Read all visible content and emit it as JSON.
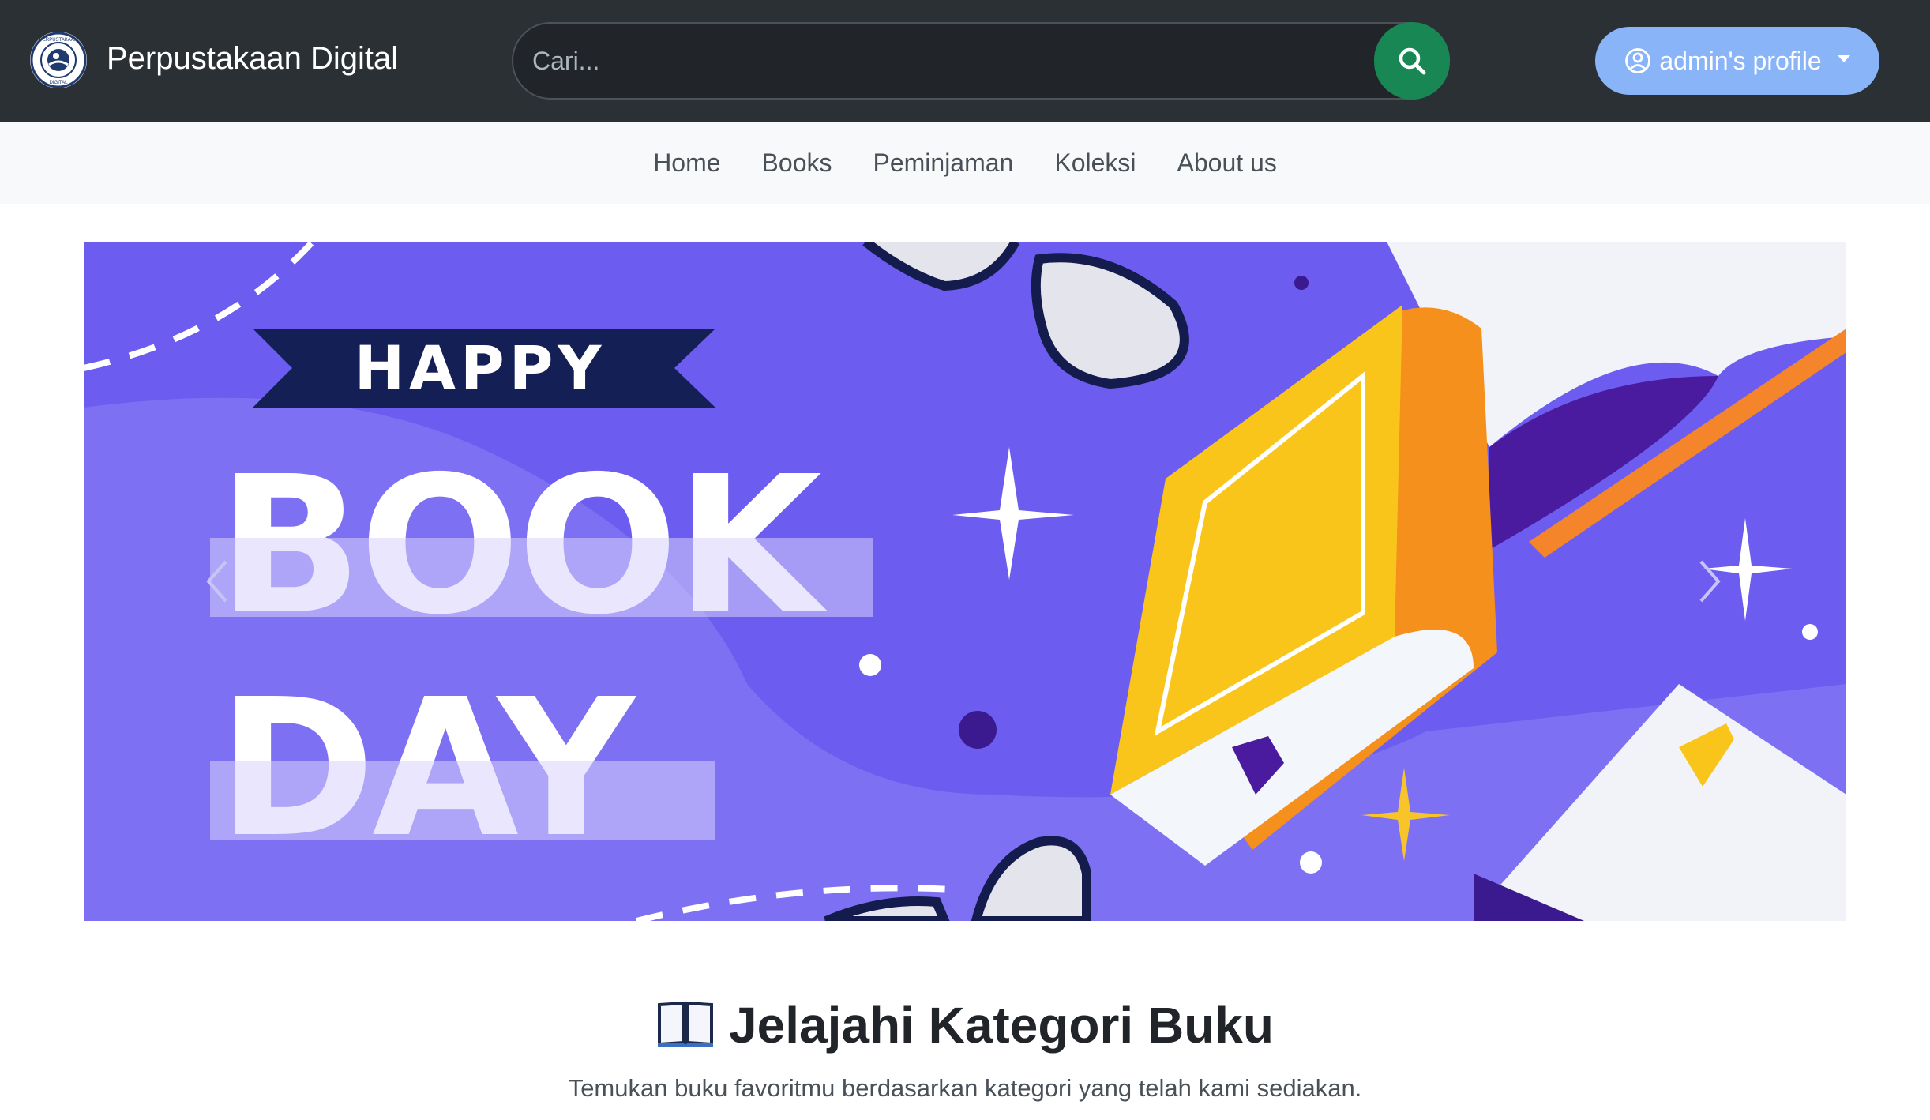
{
  "app": {
    "brand": "Perpustakaan Digital",
    "logo_text_top": "PERPUSTAKAAN",
    "logo_text_bottom": "DIGITAL"
  },
  "search": {
    "placeholder": "Cari...",
    "value": ""
  },
  "profile": {
    "label": "admin's profile"
  },
  "nav": {
    "items": [
      {
        "label": "Home"
      },
      {
        "label": "Books"
      },
      {
        "label": "Peminjaman"
      },
      {
        "label": "Koleksi"
      },
      {
        "label": "About us"
      }
    ]
  },
  "banner": {
    "line1": "HAPPY",
    "line2": "BOOK",
    "line3": "DAY"
  },
  "section": {
    "title": "Jelajahi Kategori Buku",
    "subtitle": "Temukan buku favoritmu berdasarkan kategori yang telah kami sediakan."
  },
  "colors": {
    "topbar": "#2b3035",
    "search_button": "#198754",
    "profile_button": "#8ab4f8",
    "banner_bg": "#6c5cf0"
  },
  "icons": [
    "logo-icon",
    "search-icon",
    "user-circle-icon",
    "caret-down-icon",
    "chevron-left-icon",
    "chevron-right-icon",
    "open-book-icon"
  ]
}
